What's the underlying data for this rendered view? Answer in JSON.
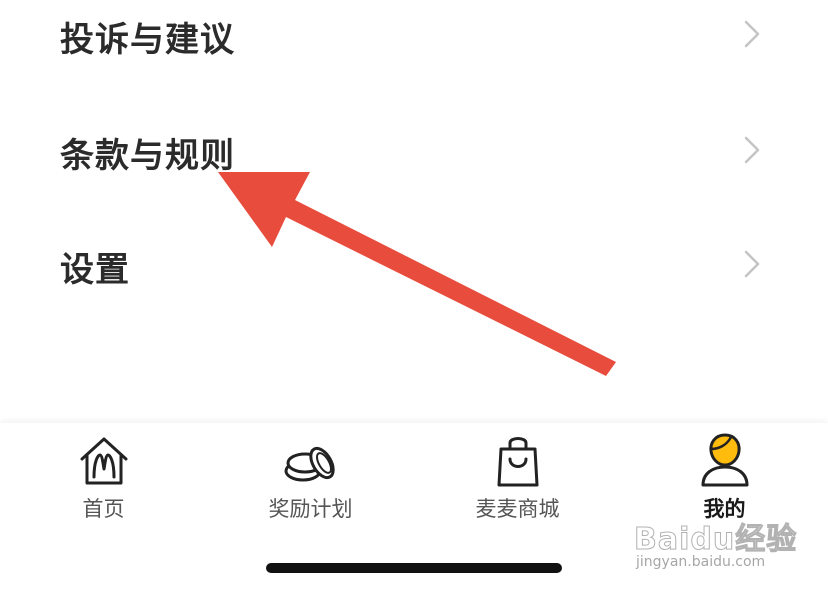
{
  "menu": {
    "items": [
      {
        "label": "投诉与建议",
        "icon": "chevron-right-icon"
      },
      {
        "label": "条款与规则",
        "icon": "chevron-right-icon"
      },
      {
        "label": "设置",
        "icon": "chevron-right-icon"
      }
    ]
  },
  "annotation": {
    "arrow_color": "#e84c3d",
    "points_to": "条款与规则"
  },
  "tabbar": {
    "tabs": [
      {
        "label": "首页",
        "icon": "home-m-icon",
        "active": false
      },
      {
        "label": "奖励计划",
        "icon": "coins-icon",
        "active": false
      },
      {
        "label": "麦麦商城",
        "icon": "shopping-bag-icon",
        "active": false
      },
      {
        "label": "我的",
        "icon": "user-icon",
        "active": true
      }
    ],
    "accent_color": "#ffbc0d"
  },
  "watermark": {
    "main": "Baidu经验",
    "sub": "jingyan.baidu.com"
  }
}
